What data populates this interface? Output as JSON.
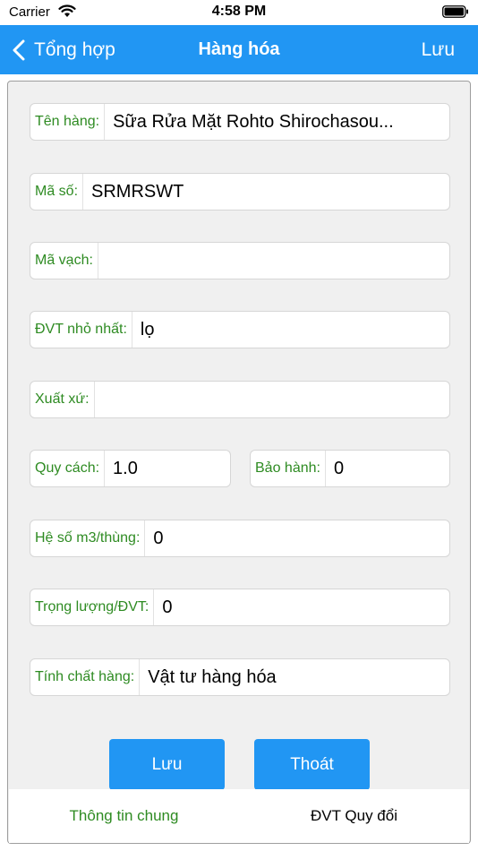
{
  "status_bar": {
    "carrier": "Carrier",
    "time": "4:58 PM"
  },
  "nav": {
    "back_label": "Tổng hợp",
    "title": "Hàng hóa",
    "save_label": "Lưu"
  },
  "form": {
    "ten_hang": {
      "label": "Tên hàng:",
      "value": "Sữa Rửa Mặt Rohto Shirochasou..."
    },
    "ma_so": {
      "label": "Mã số:",
      "value": "SRMRSWT"
    },
    "ma_vach": {
      "label": "Mã vạch:",
      "value": ""
    },
    "dvt_nho_nhat": {
      "label": "ĐVT nhỏ nhất:",
      "value": "lọ"
    },
    "xuat_xu": {
      "label": "Xuất xứ:",
      "value": ""
    },
    "quy_cach": {
      "label": "Quy cách:",
      "value": "1.0"
    },
    "bao_hanh": {
      "label": "Bảo hành:",
      "value": "0"
    },
    "he_so": {
      "label": "Hệ số m3/thùng:",
      "value": "0"
    },
    "trong_luong": {
      "label": "Trọng lượng/ĐVT:",
      "value": "0"
    },
    "tinh_chat": {
      "label": "Tính chất hàng:",
      "value": "Vật tư hàng hóa"
    }
  },
  "actions": {
    "save": "Lưu",
    "exit": "Thoát"
  },
  "tabs": [
    {
      "label": "Thông tin chung",
      "active": true
    },
    {
      "label": "ĐVT Quy đổi",
      "active": false
    }
  ],
  "colors": {
    "accent": "#2196f3",
    "label_green": "#2e8b22",
    "card_bg": "#f0f0f0"
  }
}
